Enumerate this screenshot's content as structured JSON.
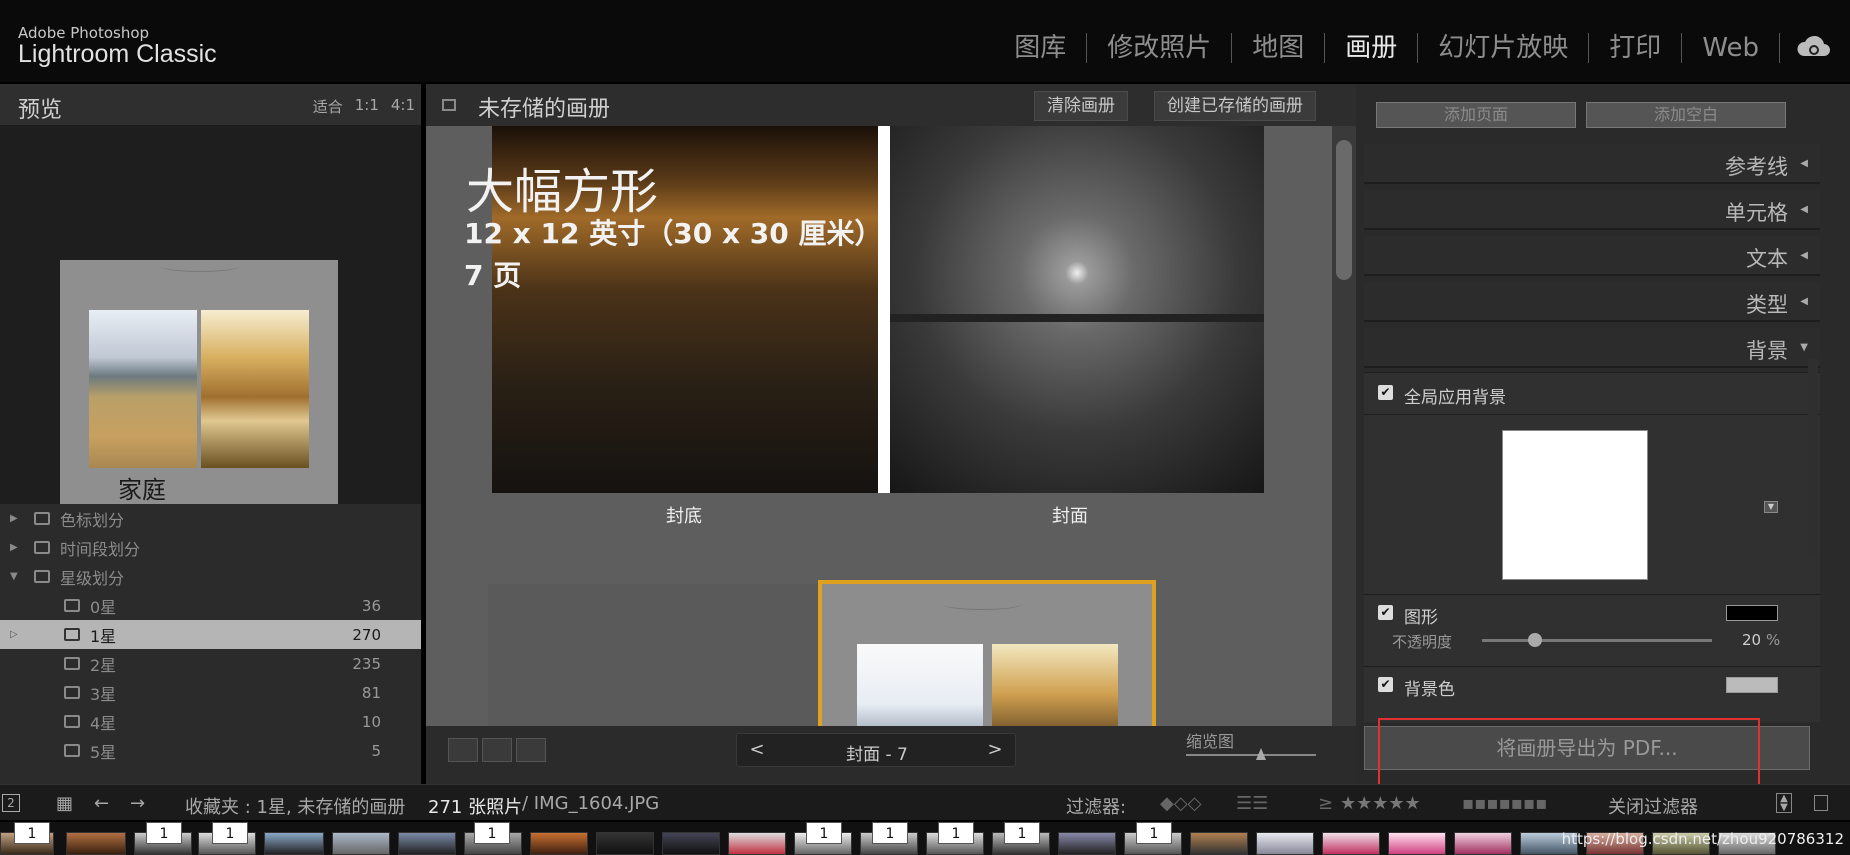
{
  "app": {
    "brand_small": "Adobe Photoshop",
    "brand_large": "Lightroom Classic"
  },
  "modules": [
    {
      "label": "图库",
      "active": false
    },
    {
      "label": "修改照片",
      "active": false
    },
    {
      "label": "地图",
      "active": false
    },
    {
      "label": "画册",
      "active": true
    },
    {
      "label": "幻灯片放映",
      "active": false
    },
    {
      "label": "打印",
      "active": false
    },
    {
      "label": "Web",
      "active": false
    }
  ],
  "left": {
    "preview_title": "预览",
    "zoom_options": [
      "适合",
      "1:1",
      "4:1"
    ],
    "thumb_label": "家庭",
    "collections": [
      {
        "label": "色标划分",
        "count": "",
        "expanded": false
      },
      {
        "label": "时间段划分",
        "count": "",
        "expanded": false
      },
      {
        "label": "星级划分",
        "count": "",
        "expanded": true
      },
      {
        "label": "0星",
        "count": "36"
      },
      {
        "label": "1星",
        "count": "270",
        "selected": true
      },
      {
        "label": "2星",
        "count": "235"
      },
      {
        "label": "3星",
        "count": "81"
      },
      {
        "label": "4星",
        "count": "10"
      },
      {
        "label": "5星",
        "count": "5"
      }
    ]
  },
  "center": {
    "title": "未存储的画册",
    "clear_btn": "清除画册",
    "create_btn": "创建已存储的画册",
    "book_title": "大幅方形",
    "book_size": "12 x 12 英寸（30 x 30 厘米）",
    "book_pages": "7 页",
    "back_label": "封底",
    "front_label": "封面",
    "pager_label": "封面 - 7",
    "zoom_label": "缩览图"
  },
  "right": {
    "add_page": "添加页面",
    "add_blank": "添加空白",
    "sections": [
      "参考线",
      "单元格",
      "文本",
      "类型",
      "背景"
    ],
    "global_bg": "全局应用背景",
    "graphic": "图形",
    "opacity_label": "不透明度",
    "opacity_value": "20",
    "opacity_unit": "%",
    "bg_color": "背景色",
    "export_btn": "将画册导出为 PDF..."
  },
  "filterbar": {
    "page_badge": "2",
    "collection": "收藏夹 : 1星, 未存储的画册",
    "count": "271 张照片",
    "filename": "/ IMG_1604.JPG",
    "filter_label": "过滤器:",
    "stars_prefix": "≥",
    "stars": "★★★★★",
    "close_filter": "关闭过滤器"
  },
  "filmstrip": {
    "badge": "1",
    "watermark": "https://blog.csdn.net/zhou920786312"
  },
  "colors": {
    "accent": "#e0a020",
    "highlight_red": "#e03030"
  }
}
